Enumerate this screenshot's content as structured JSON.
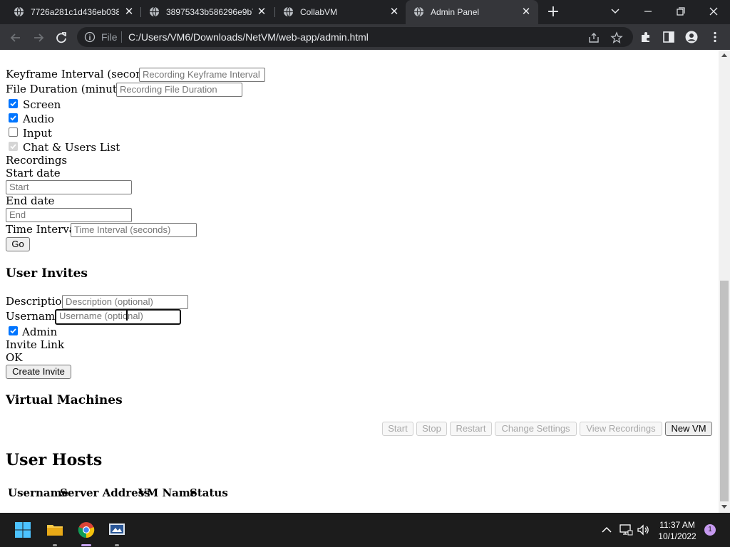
{
  "browser": {
    "tabs": [
      {
        "title": "7726a281c1d436eb038",
        "active": false
      },
      {
        "title": "38975343b586296e9b7",
        "active": false
      },
      {
        "title": "CollabVM",
        "active": false
      },
      {
        "title": "Admin Panel",
        "active": true
      }
    ],
    "address": {
      "scheme_label": "File",
      "url": "C:/Users/VM6/Downloads/NetVM/web-app/admin.html"
    }
  },
  "recording": {
    "keyframe_label": "Keyframe Interval (seconds)",
    "keyframe_placeholder": "Recording Keyframe Interval",
    "file_duration_label": "File Duration (minutes)",
    "file_duration_placeholder": "Recording File Duration",
    "checkboxes": [
      {
        "label": "Screen",
        "checked": true,
        "disabled": false
      },
      {
        "label": "Audio",
        "checked": true,
        "disabled": false
      },
      {
        "label": "Input",
        "checked": false,
        "disabled": false
      },
      {
        "label": "Chat & Users List",
        "checked": true,
        "disabled": true
      }
    ]
  },
  "recordings": {
    "heading": "Recordings",
    "start_label": "Start date",
    "start_placeholder": "Start",
    "end_label": "End date",
    "end_placeholder": "End",
    "interval_label": "Time Interval",
    "interval_placeholder": "Time Interval (seconds)",
    "go_button": "Go"
  },
  "user_invites": {
    "heading": "User Invites",
    "description_label": "Description",
    "description_placeholder": "Description (optional)",
    "username_label": "Username",
    "username_placeholder": "Username (optional)",
    "admin_label": "Admin",
    "admin_checked": true,
    "invite_link_label": "Invite Link",
    "status_text": "OK",
    "create_button": "Create Invite"
  },
  "virtual_machines": {
    "heading": "Virtual Machines",
    "buttons": [
      {
        "label": "Start",
        "enabled": false
      },
      {
        "label": "Stop",
        "enabled": false
      },
      {
        "label": "Restart",
        "enabled": false
      },
      {
        "label": "Change Settings",
        "enabled": false
      },
      {
        "label": "View Recordings",
        "enabled": false
      },
      {
        "label": "New VM",
        "enabled": true
      }
    ]
  },
  "user_hosts": {
    "heading": "User Hosts",
    "columns": [
      "Username",
      "Server Address",
      "VM Name",
      "Status"
    ]
  },
  "taskbar": {
    "time": "11:37 AM",
    "date": "10/1/2022",
    "notification_count": "1"
  },
  "colors": {
    "tabstrip": "#202124",
    "toolbar": "#35363a",
    "checkbox_accent": "#0075ff",
    "taskbar": "#1c1c1c"
  }
}
